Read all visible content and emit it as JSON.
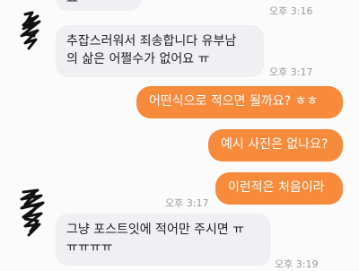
{
  "messages": [
    {
      "text": "요",
      "time": "오후 3:16"
    },
    {
      "lines": [
        "추잡스러워서 죄송합니다 유부남",
        "의 삶은 어쩔수가 없어요 ㅠ"
      ],
      "time": "오후 3:17"
    },
    {
      "text": "어떤식으로 적으면 될까요? ㅎㅎ"
    },
    {
      "text": "예시 사진은 없나요?"
    },
    {
      "text": "이런적은 처음이라",
      "time": "오후 3:17"
    },
    {
      "lines": [
        "그냥 포스트잇에 적어만 주시면 ㅠ",
        "ㅠㅠㅠㅠ"
      ],
      "time": "오후 3:19"
    }
  ],
  "colors": {
    "outgoing_bubble": "#f88a3c",
    "incoming_bubble": "#f0f0f2",
    "timestamp": "#9a9aa0"
  },
  "icons": {
    "avatar": "scribbled-out-avatar-icon"
  }
}
